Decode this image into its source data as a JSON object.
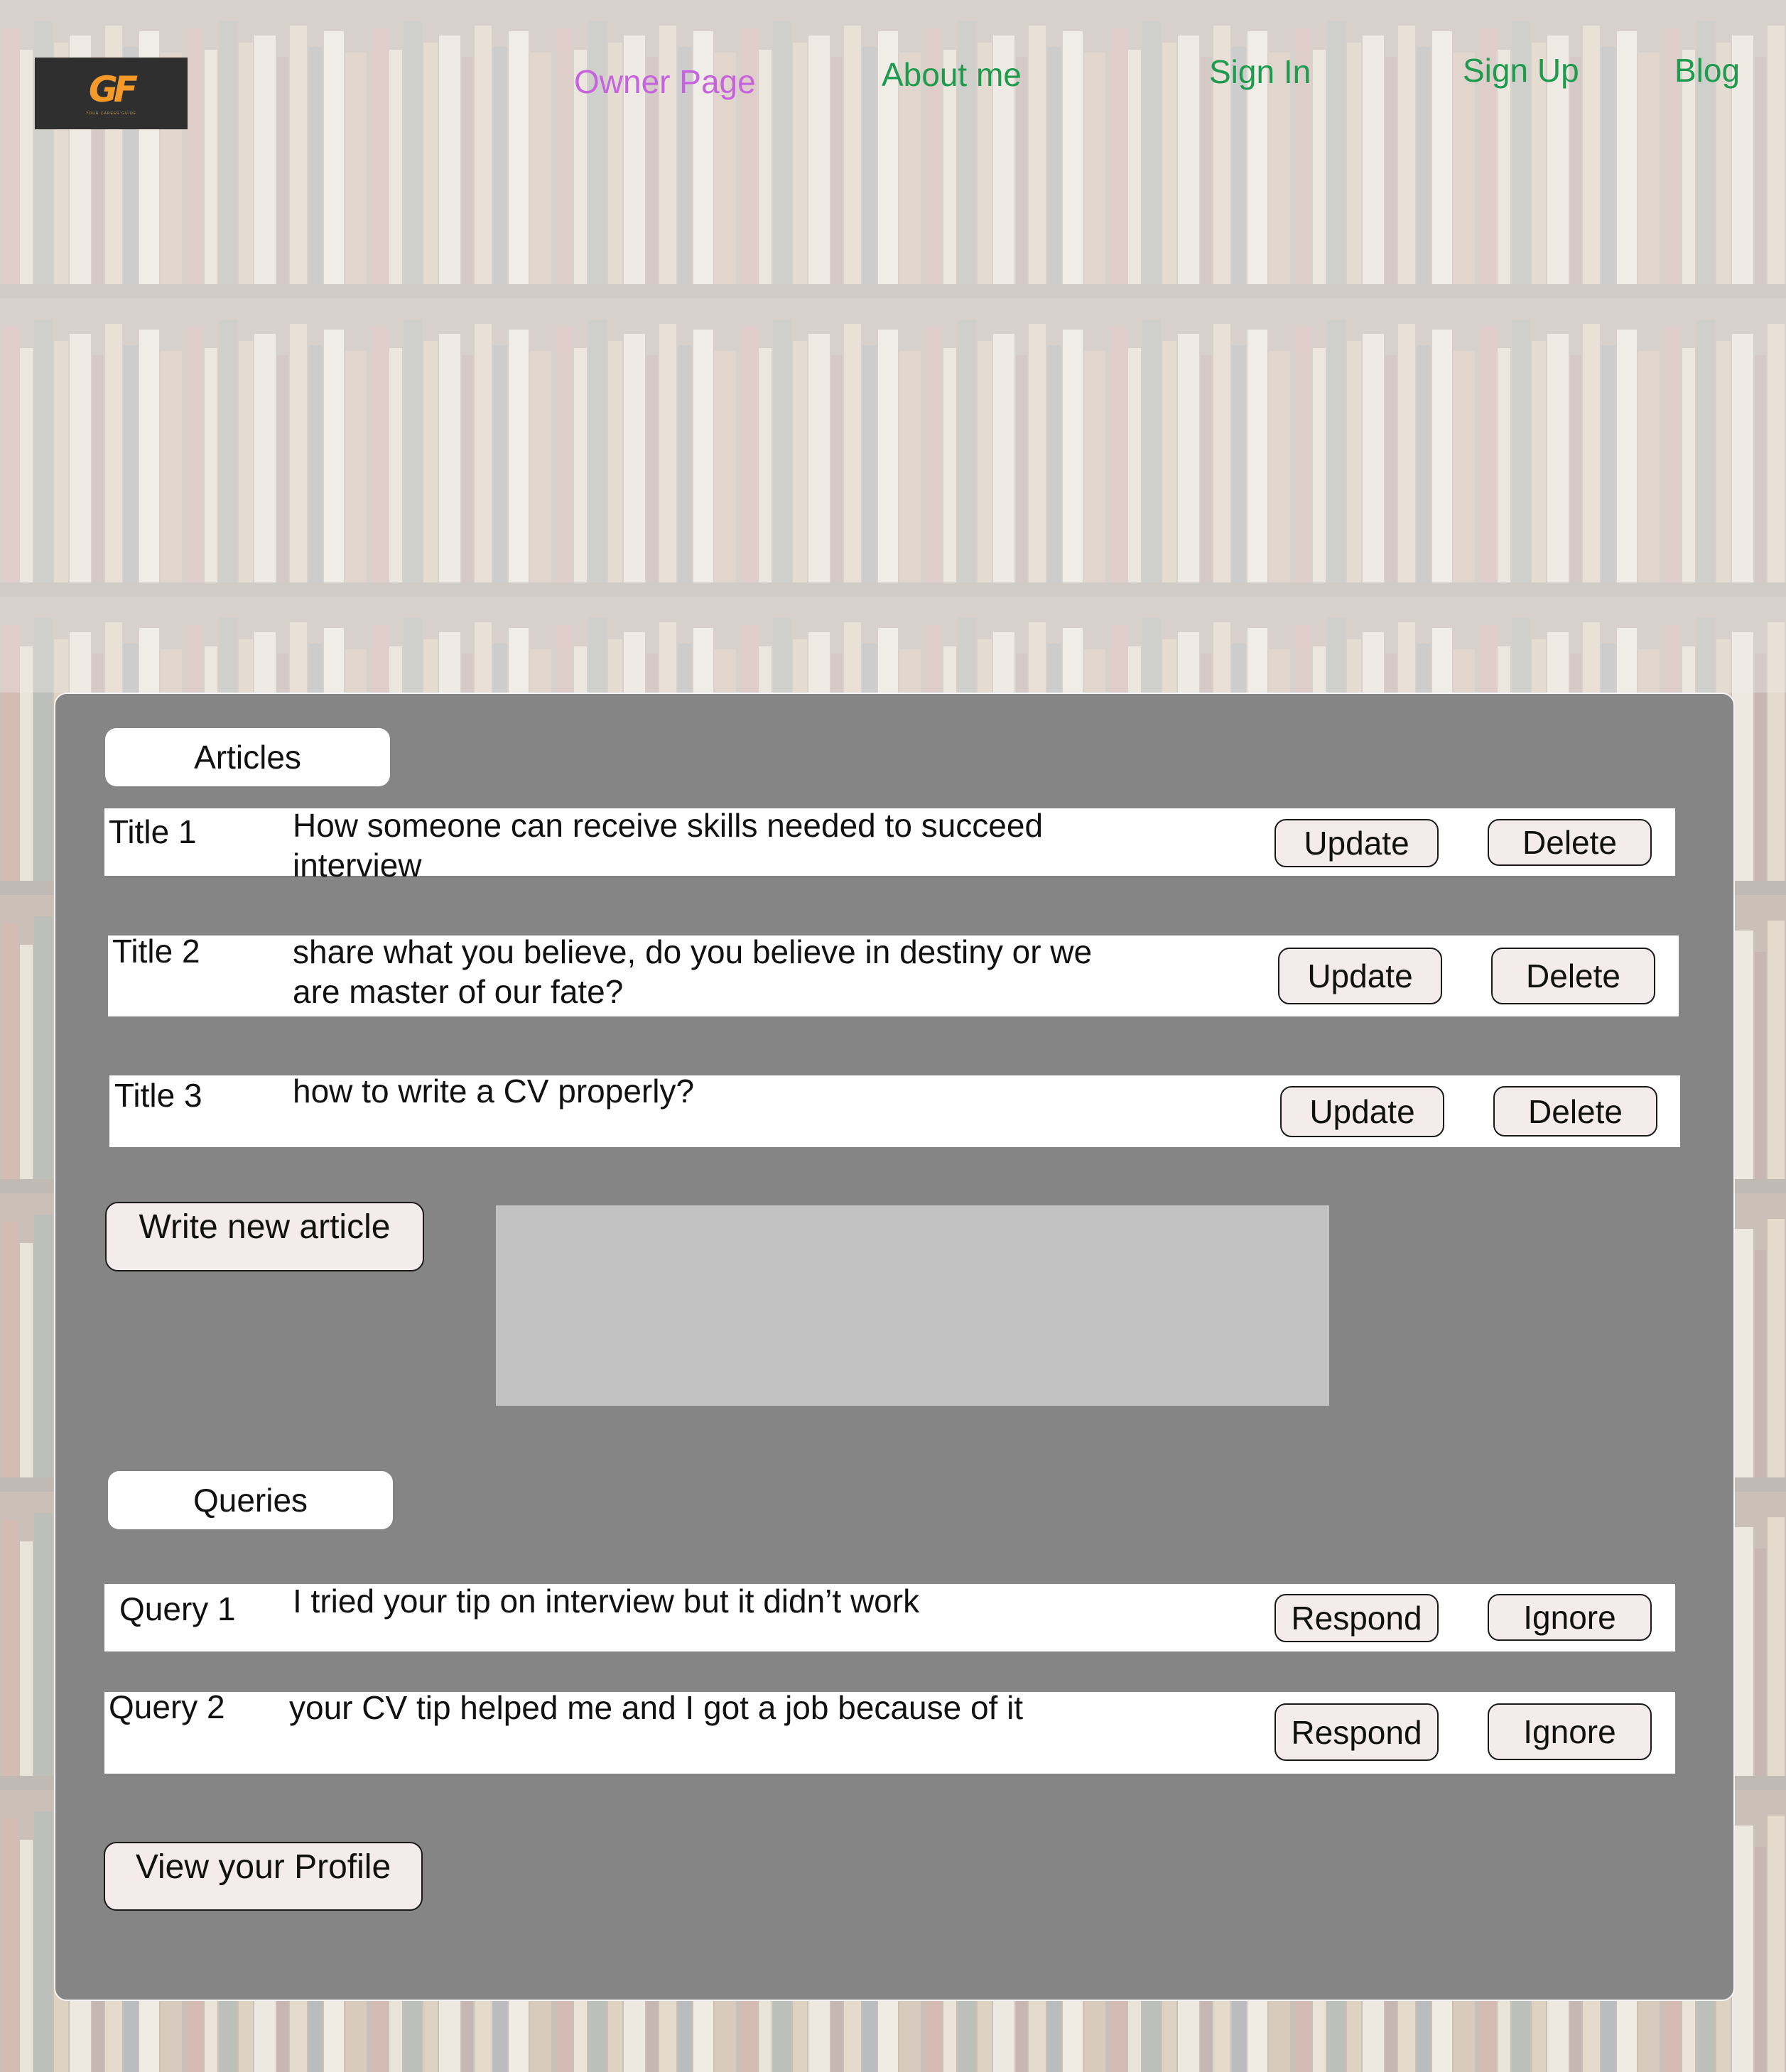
{
  "header": {
    "logo": {
      "mark": "GF",
      "tagline": "YOUR CAREER GUIDE"
    },
    "nav": [
      {
        "label": "Owner Page",
        "active": true
      },
      {
        "label": "About me",
        "active": false
      },
      {
        "label": "Sign In",
        "active": false
      },
      {
        "label": "Sign Up",
        "active": false
      },
      {
        "label": "Blog",
        "active": false
      }
    ]
  },
  "articles": {
    "heading": "Articles",
    "rows": [
      {
        "title": "Title 1",
        "text": "How someone can receive skills needed to succeed interview",
        "update_label": "Update",
        "delete_label": "Delete"
      },
      {
        "title": "Title 2",
        "text": "share what you believe, do you believe in destiny or we are master of our fate?",
        "update_label": "Update",
        "delete_label": "Delete"
      },
      {
        "title": "Title 3",
        "text": "how to write a CV properly?",
        "update_label": "Update",
        "delete_label": "Delete"
      }
    ],
    "write_button": "Write new article"
  },
  "queries": {
    "heading": "Queries",
    "rows": [
      {
        "title": "Query 1",
        "text": "I tried your tip on interview but it didn’t work",
        "respond_label": "Respond",
        "ignore_label": "Ignore"
      },
      {
        "title": "Query 2",
        "text": "your CV tip helped me and I got a job because of it",
        "respond_label": "Respond",
        "ignore_label": "Ignore"
      }
    ]
  },
  "profile_button": "View your Profile",
  "colors": {
    "nav_active": "#c564dc",
    "nav_link": "#1f9a4f",
    "panel": "#858585",
    "button_fill": "#f4ecec",
    "logo_accent": "#f39a2a"
  }
}
